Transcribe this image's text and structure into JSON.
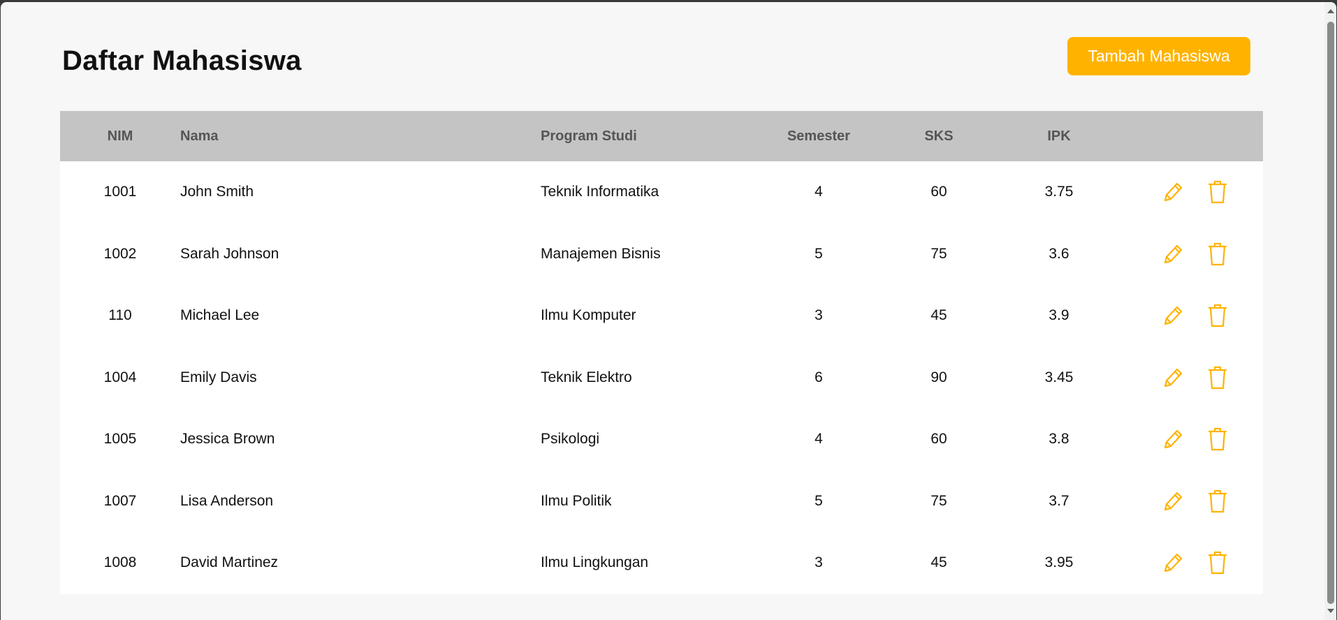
{
  "page": {
    "title": "Daftar Mahasiswa",
    "add_button_label": "Tambah Mahasiswa",
    "accent_color": "#ffb300"
  },
  "table": {
    "headers": {
      "nim": "NIM",
      "nama": "Nama",
      "program_studi": "Program Studi",
      "semester": "Semester",
      "sks": "SKS",
      "ipk": "IPK"
    },
    "rows": [
      {
        "nim": "1001",
        "nama": "John Smith",
        "program_studi": "Teknik Informatika",
        "semester": "4",
        "sks": "60",
        "ipk": "3.75"
      },
      {
        "nim": "1002",
        "nama": "Sarah Johnson",
        "program_studi": "Manajemen Bisnis",
        "semester": "5",
        "sks": "75",
        "ipk": "3.6"
      },
      {
        "nim": "110",
        "nama": "Michael Lee",
        "program_studi": "Ilmu Komputer",
        "semester": "3",
        "sks": "45",
        "ipk": "3.9"
      },
      {
        "nim": "1004",
        "nama": "Emily Davis",
        "program_studi": "Teknik Elektro",
        "semester": "6",
        "sks": "90",
        "ipk": "3.45"
      },
      {
        "nim": "1005",
        "nama": "Jessica Brown",
        "program_studi": "Psikologi",
        "semester": "4",
        "sks": "60",
        "ipk": "3.8"
      },
      {
        "nim": "1007",
        "nama": "Lisa Anderson",
        "program_studi": "Ilmu Politik",
        "semester": "5",
        "sks": "75",
        "ipk": "3.7"
      },
      {
        "nim": "1008",
        "nama": "David Martinez",
        "program_studi": "Ilmu Lingkungan",
        "semester": "3",
        "sks": "45",
        "ipk": "3.95"
      }
    ],
    "row_actions": [
      "pencil-icon",
      "trash-icon"
    ]
  }
}
